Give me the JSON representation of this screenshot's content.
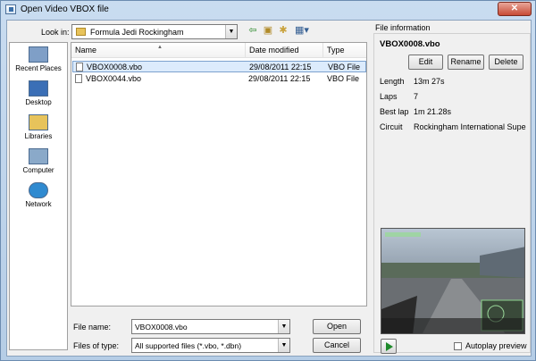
{
  "window": {
    "title": "Open Video VBOX file",
    "close_glyph": "✕"
  },
  "lookin": {
    "label": "Look in:",
    "value": "Formula Jedi Rockingham"
  },
  "toolbar_icons": [
    "back-arrow-icon",
    "up-folder-icon",
    "new-folder-icon",
    "view-menu-icon"
  ],
  "places": [
    {
      "label": "Recent Places",
      "icon": "recent-places-icon",
      "color": "#7f9fc7"
    },
    {
      "label": "Desktop",
      "icon": "desktop-icon",
      "color": "#3b6fb6"
    },
    {
      "label": "Libraries",
      "icon": "libraries-icon",
      "color": "#e7c35b"
    },
    {
      "label": "Computer",
      "icon": "computer-icon",
      "color": "#8aa9c9"
    },
    {
      "label": "Network",
      "icon": "network-icon",
      "color": "#2f8ad0"
    }
  ],
  "columns": [
    "Name",
    "Date modified",
    "Type"
  ],
  "files": [
    {
      "name": "VBOX0008.vbo",
      "date": "29/08/2011 22:15",
      "type": "VBO File",
      "selected": true
    },
    {
      "name": "VBOX0044.vbo",
      "date": "29/08/2011 22:15",
      "type": "VBO File",
      "selected": false
    }
  ],
  "filename": {
    "label": "File name:",
    "value": "VBOX0008.vbo"
  },
  "filetype": {
    "label": "Files of type:",
    "value": "All supported files (*.vbo, *.dbn)"
  },
  "buttons": {
    "open": "Open",
    "cancel": "Cancel"
  },
  "info": {
    "header": "File information",
    "file": "VBOX0008.vbo",
    "edit": "Edit",
    "rename": "Rename",
    "delete": "Delete",
    "fields": [
      {
        "key": "Length",
        "value": "13m 27s"
      },
      {
        "key": "Laps",
        "value": "7"
      },
      {
        "key": "Best lap",
        "value": "1m 21.28s"
      },
      {
        "key": "Circuit",
        "value": "Rockingham International Supe"
      }
    ],
    "autoplay_label": "Autoplay preview",
    "autoplay_checked": false
  },
  "colors": {
    "selection": "#dcebfc",
    "play": "#1e8a2a",
    "title_bar": "#c9dcf0"
  }
}
